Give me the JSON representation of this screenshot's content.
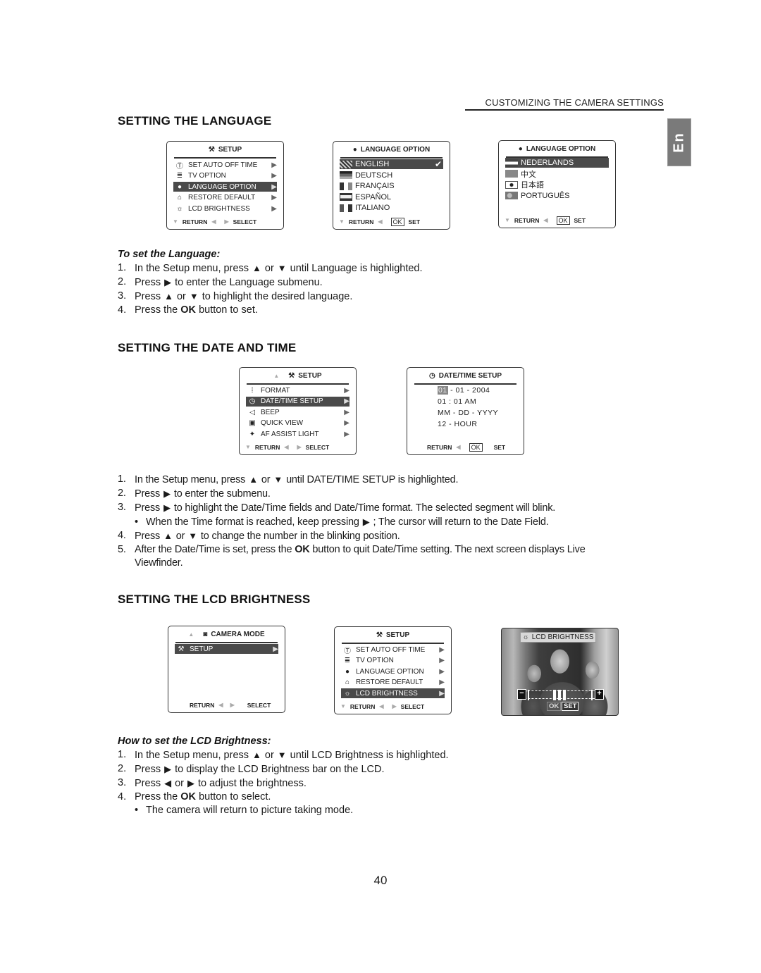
{
  "header": {
    "running_title": "CUSTOMIZING THE CAMERA SETTINGS",
    "language_tab": "En"
  },
  "sections": {
    "language": {
      "title": "SETTING THE LANGUAGE",
      "subtitle": "To set the Language:",
      "steps": [
        {
          "n": "1.",
          "a": "In the Setup menu, press",
          "b": "or",
          "c": "until Language is highlighted."
        },
        {
          "n": "2.",
          "a": "Press",
          "c": "to enter the Language submenu."
        },
        {
          "n": "3.",
          "a": "Press",
          "b": "or",
          "c": "to highlight the desired language."
        },
        {
          "n": "4.",
          "a": "Press the",
          "bold": "OK",
          "c": "button to set."
        }
      ]
    },
    "datetime": {
      "title": "SETTING THE DATE AND TIME",
      "steps": [
        {
          "n": "1.",
          "a": "In the Setup menu, press",
          "b": "or",
          "c": "until DATE/TIME SETUP is highlighted."
        },
        {
          "n": "2.",
          "a": "Press",
          "c": "to enter the submenu."
        },
        {
          "n": "3.",
          "a": "Press",
          "c": "to highlight the Date/Time fields and Date/Time format. The selected segment will blink."
        },
        {
          "bullet": "•",
          "a": "When the Time format is reached, keep pressing",
          "c": "; The cursor will return to the Date Field."
        },
        {
          "n": "4.",
          "a": "Press",
          "b": "or",
          "c": "to change the number in the blinking position."
        },
        {
          "n": "5.",
          "a": "After the Date/Time is set, press the",
          "bold": "OK",
          "c": "button to quit Date/Time setting. The next screen displays Live",
          "d": "Viewfinder."
        }
      ]
    },
    "lcd": {
      "title": "SETTING THE LCD BRIGHTNESS",
      "subtitle": "How to set the LCD Brightness:",
      "steps": [
        {
          "n": "1.",
          "a": "In the Setup menu, press",
          "b": "or",
          "c": "until LCD Brightness is highlighted."
        },
        {
          "n": "2.",
          "a": "Press",
          "c": "to display the LCD Brightness bar on the LCD."
        },
        {
          "n": "3.",
          "a": "Press",
          "b": "or",
          "c": "to adjust the brightness."
        },
        {
          "n": "4.",
          "a": "Press the",
          "bold": "OK",
          "c": "button to select."
        },
        {
          "bullet": "•",
          "a": "The camera will return to picture taking mode."
        }
      ]
    }
  },
  "glyphs": {
    "up": "▲",
    "down": "▼",
    "right": "▶",
    "left": "◀"
  },
  "screens": {
    "setup_lang": {
      "title": "SETUP",
      "items": [
        {
          "icon": "Ⓣ",
          "label": "SET AUTO OFF TIME"
        },
        {
          "icon": "≣",
          "label": "TV OPTION"
        },
        {
          "icon": "●",
          "label": "LANGUAGE OPTION"
        },
        {
          "icon": "⌂",
          "label": "RESTORE DEFAULT"
        },
        {
          "icon": "☼",
          "label": "LCD BRIGHTNESS"
        }
      ],
      "highlighted": "LANGUAGE OPTION",
      "footer": {
        "return": "RETURN",
        "select": "SELECT"
      }
    },
    "language_option_1": {
      "title": "LANGUAGE  OPTION",
      "items": [
        "ENGLISH",
        "DEUTSCH",
        "FRANÇAIS",
        "ESPAÑOL",
        "ITALIANO"
      ],
      "selected": "ENGLISH",
      "checkmark": "✔",
      "footer": {
        "return": "RETURN",
        "ok": "OK",
        "set": "SET"
      }
    },
    "language_option_2": {
      "title": "LANGUAGE  OPTION",
      "items": [
        "NEDERLANDS",
        "中文",
        "日本語",
        "PORTUGUÊS"
      ],
      "selected": "NEDERLANDS",
      "footer": {
        "return": "RETURN",
        "ok": "OK",
        "set": "SET"
      }
    },
    "setup_datetime": {
      "title": "SETUP",
      "items": [
        {
          "icon": "⁞",
          "label": "FORMAT"
        },
        {
          "icon": "◷",
          "label": "DATE/TIME SETUP"
        },
        {
          "icon": "◁",
          "label": "BEEP"
        },
        {
          "icon": "▣",
          "label": "QUICK VIEW"
        },
        {
          "icon": "✦",
          "label": "AF ASSIST LIGHT"
        }
      ],
      "highlighted": "DATE/TIME SETUP",
      "footer": {
        "return": "RETURN",
        "select": "SELECT"
      }
    },
    "datetime_setup": {
      "title": "DATE/TIME SETUP",
      "date_month": "01",
      "date_rest": " - 01 - 2004",
      "time": "01 : 01 AM",
      "date_format": "MM - DD - YYYY",
      "hour_format": "12 - HOUR",
      "footer": {
        "return": "RETURN",
        "ok": "OK",
        "set": "SET"
      }
    },
    "camera_mode": {
      "title": "CAMERA MODE",
      "items": [
        {
          "icon": "⚒",
          "label": "SETUP"
        }
      ],
      "highlighted": "SETUP",
      "footer": {
        "return": "RETURN",
        "select": "SELECT"
      }
    },
    "setup_lcd": {
      "title": "SETUP",
      "items": [
        {
          "icon": "Ⓣ",
          "label": "SET AUTO OFF TIME"
        },
        {
          "icon": "≣",
          "label": "TV OPTION"
        },
        {
          "icon": "●",
          "label": "LANGUAGE OPTION"
        },
        {
          "icon": "⌂",
          "label": "RESTORE DEFAULT"
        },
        {
          "icon": "☼",
          "label": "LCD BRIGHTNESS"
        }
      ],
      "highlighted": "LCD BRIGHTNESS",
      "footer": {
        "return": "RETURN",
        "select": "SELECT"
      }
    },
    "lcd_brightness": {
      "title": "LCD BRIGHTNESS",
      "minus": "−",
      "plus": "+",
      "level": 0.5,
      "ok": "OK",
      "set": "SET"
    }
  },
  "page_number": "40"
}
